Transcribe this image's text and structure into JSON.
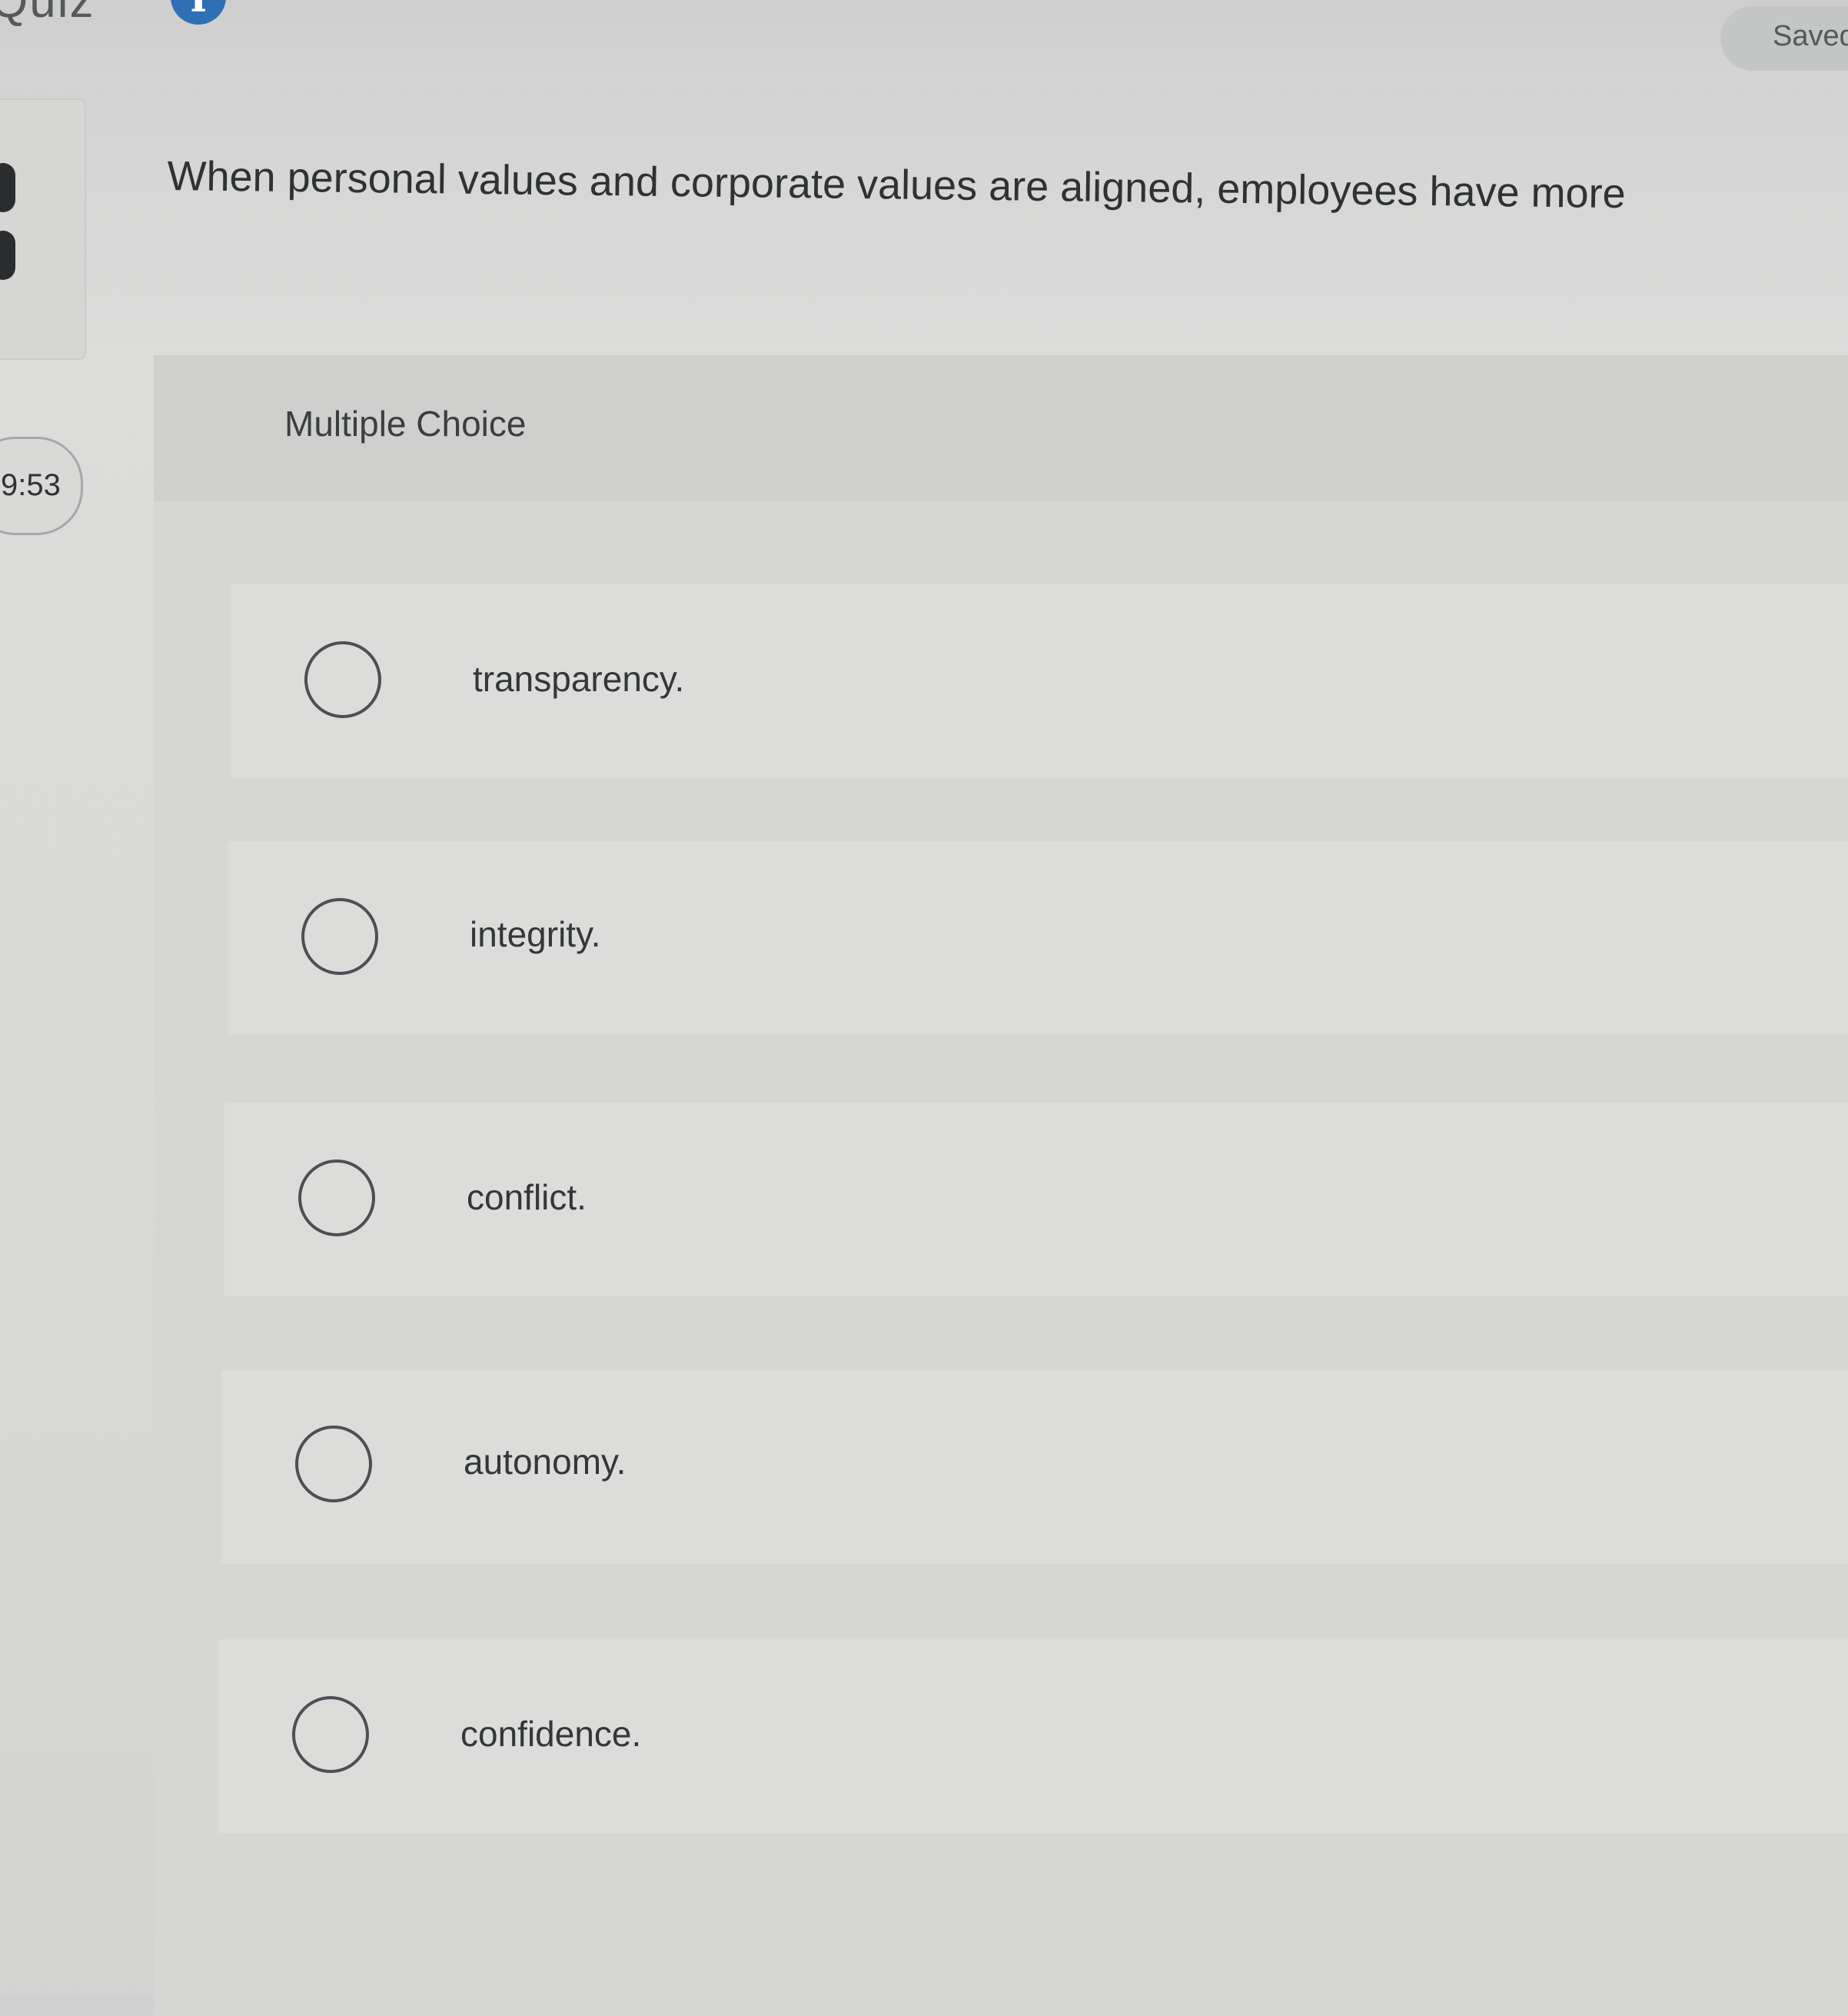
{
  "header": {
    "title": "Quiz",
    "info_icon": "info-icon",
    "saved_label": "Saved"
  },
  "timer": {
    "label": "9:53"
  },
  "question": {
    "text": "When personal values and corporate values are aligned, employees have more",
    "type_label": "Multiple Choice"
  },
  "options": [
    {
      "label": "transparency.",
      "selected": false
    },
    {
      "label": "integrity.",
      "selected": false
    },
    {
      "label": "conflict.",
      "selected": false
    },
    {
      "label": "autonomy.",
      "selected": false
    },
    {
      "label": "confidence.",
      "selected": false
    }
  ]
}
